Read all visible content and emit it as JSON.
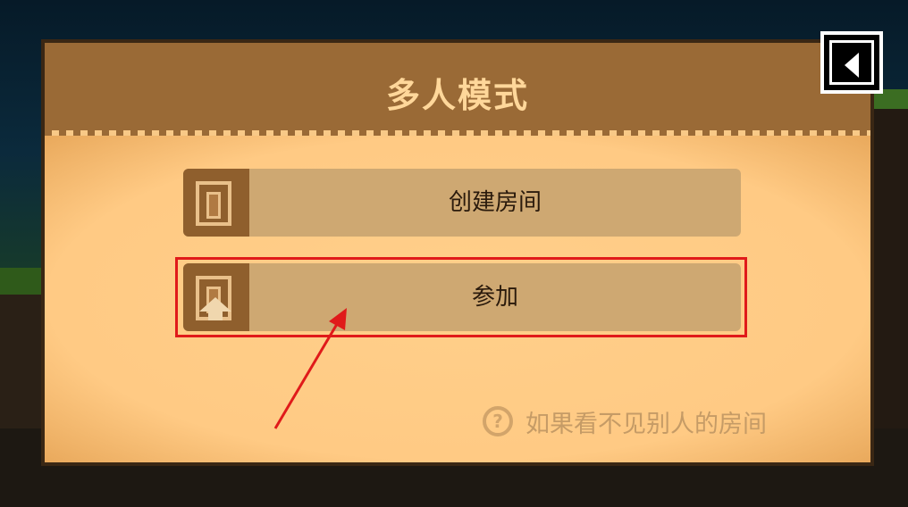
{
  "dialog": {
    "title": "多人模式",
    "buttons": [
      {
        "label": "创建房间",
        "icon": "door-icon"
      },
      {
        "label": "参加",
        "icon": "door-enter-icon"
      }
    ],
    "help": {
      "icon": "question-icon",
      "text": "如果看不见别人的房间"
    }
  },
  "back_button": {
    "icon": "back-arrow-icon"
  },
  "annotation": {
    "color": "#e01a1a"
  },
  "colors": {
    "header": "#9a6a36",
    "panel": "#ffca84",
    "button": "#cea872",
    "title_text": "#ffd79a"
  }
}
